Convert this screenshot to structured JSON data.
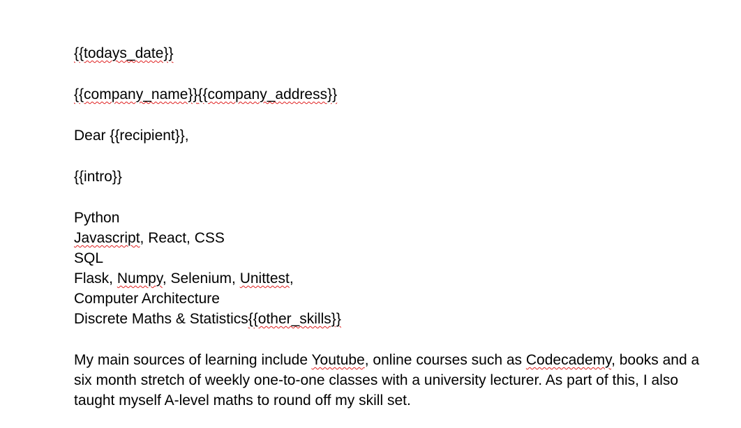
{
  "document": {
    "date_placeholder": "{{todays_date}}",
    "company_name_placeholder": "{{company_name}}",
    "company_address_placeholder": "{{company_address}}",
    "salutation_prefix": "Dear ",
    "salutation_placeholder": "{{recipient}}",
    "salutation_suffix": ",",
    "intro_placeholder": "{{intro}}",
    "skills": {
      "line1": "Python",
      "line2_word1": "Javascript",
      "line2_rest": ", React, CSS",
      "line3": "SQL",
      "line4_prefix": "Flask, ",
      "line4_numpy": "Numpy",
      "line4_middle": ", Selenium, ",
      "line4_unittest": "Unittest",
      "line4_suffix": ",",
      "line5": "Computer Architecture",
      "line6_prefix": "Discrete Maths & Statistics",
      "line6_placeholder": "{{other_skills}}"
    },
    "body": {
      "part1": "My main sources of learning include ",
      "youtube": "Youtube",
      "part2": ", online courses such as ",
      "codecademy": "Codecademy",
      "part3": ", books and a six month stretch of weekly one-to-one classes with a university lecturer. As part of this, I also taught myself A-level maths to round off my skill set."
    }
  },
  "colors": {
    "spelling_underline": "#e02020",
    "grammar_underline": "#3a64c8"
  }
}
